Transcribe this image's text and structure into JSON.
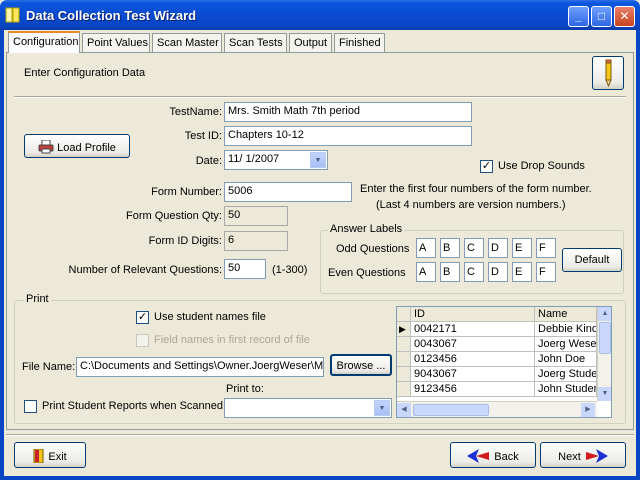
{
  "window": {
    "title": "Data Collection Test Wizard",
    "minimize": "_",
    "maximize": "□",
    "close": "✕"
  },
  "tabs": [
    "Configuration",
    "Point Values",
    "Scan Master",
    "Scan Tests",
    "Output",
    "Finished"
  ],
  "header": {
    "text": "Enter Configuration Data"
  },
  "form": {
    "testname_label": "TestName:",
    "testname_value": "Mrs. Smith Math 7th period",
    "testid_label": "Test ID:",
    "testid_value": "Chapters 10-12",
    "date_label": "Date:",
    "date_value": "11/  1/2007",
    "load_profile_label": "Load Profile",
    "use_drop_sounds_label": "Use Drop Sounds",
    "use_drop_sounds_checked": "✓",
    "form_number_label": "Form Number:",
    "form_number_value": "5006",
    "form_hint_1": "Enter the first four numbers of the form number.",
    "form_hint_2": "(Last 4 numbers are version numbers.)",
    "question_qty_label": "Form Question Qty:",
    "question_qty_value": "50",
    "form_id_digits_label": "Form ID Digits:",
    "form_id_digits_value": "6",
    "relevant_questions_label": "Number of Relevant Questions:",
    "relevant_questions_value": "50",
    "relevant_questions_range": "(1-300)"
  },
  "answer_labels": {
    "title": "Answer Labels",
    "odd_label": "Odd Questions",
    "even_label": "Even Questions",
    "odd": [
      "A",
      "B",
      "C",
      "D",
      "E",
      "F"
    ],
    "even": [
      "A",
      "B",
      "C",
      "D",
      "E",
      "F"
    ],
    "default_button": "Default"
  },
  "print": {
    "title": "Print",
    "use_student_names_label": "Use student names file",
    "use_student_names_checked": "✓",
    "field_names_label": "Field names in first record of file",
    "file_name_label": "File Name:",
    "file_name_value": "C:\\Documents and Settings\\Owner.JoergWeser\\M",
    "browse_button": "Browse ...",
    "print_reports_label": "Print Student Reports when Scanned",
    "print_to_label": "Print to:",
    "print_to_value": ""
  },
  "grid": {
    "columns": [
      "ID",
      "Name"
    ],
    "rows": [
      [
        "0042171",
        "Debbie Kind"
      ],
      [
        "0043067",
        "Joerg Weser"
      ],
      [
        "0123456",
        "John Doe"
      ],
      [
        "9043067",
        "Joerg Studen"
      ],
      [
        "9123456",
        "John Studen"
      ]
    ],
    "current_row_marker": "▶"
  },
  "footer": {
    "exit_button": "Exit",
    "back_button": "Back",
    "next_button": "Next"
  },
  "colors": {
    "titlebar": "#0a4bd1",
    "window_bg": "#ece9d8",
    "tab_accent": "#e68b2c",
    "arrow_blue": "#1b2fd4",
    "arrow_red": "#d41b1b"
  },
  "icons": {
    "app": "app-icon",
    "pencil": "pencil-icon",
    "printer": "printer-icon",
    "exit_door": "exit-door-icon",
    "back_arrow": "back-arrow-icon",
    "next_arrow": "next-arrow-icon"
  }
}
